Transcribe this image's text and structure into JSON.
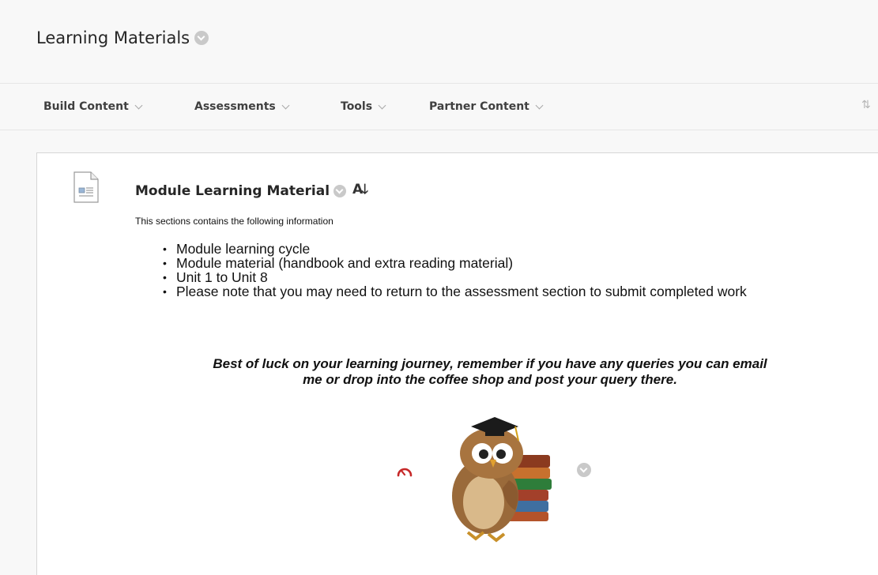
{
  "header": {
    "title": "Learning Materials"
  },
  "toolbar": {
    "items": [
      {
        "label": "Build Content"
      },
      {
        "label": "Assessments"
      },
      {
        "label": "Tools"
      },
      {
        "label": "Partner Content"
      }
    ]
  },
  "content_item": {
    "title": "Module Learning Material",
    "intro": "This sections contains the following information",
    "bullets": [
      "Module learning cycle",
      "Module material (handbook and extra reading material)",
      "Unit 1 to Unit 8",
      "Please note that you may need to return to the assessment section to submit completed work"
    ],
    "closing_line_1": "Best of luck on your learning journey, remember if you have any queries you can email",
    "closing_line_2": "me or drop into the coffee shop and post your query there.",
    "az_label": "A"
  },
  "icons": {
    "page_title_menu": "chevron-down-circle-icon",
    "sort": "reorder-arrows-icon",
    "document": "document-icon",
    "item_menu": "chevron-down-circle-icon",
    "text_sort": "a-z-sort-icon",
    "gauge": "gauge-icon",
    "image_menu": "chevron-down-circle-icon"
  },
  "colors": {
    "gauge": "#c62828",
    "chevron_circle": "#c9c9c9"
  }
}
